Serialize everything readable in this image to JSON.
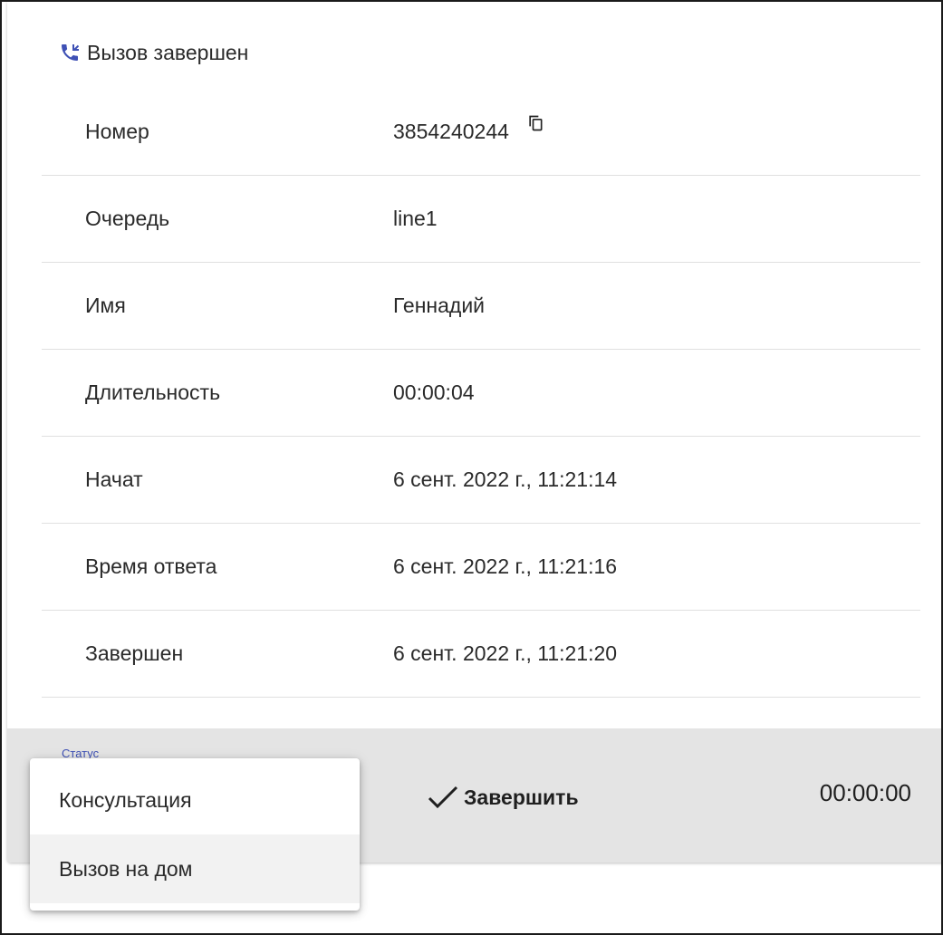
{
  "header": {
    "title": "Вызов завершен",
    "icon": "phone-callback-icon",
    "icon_color": "#3f51b5"
  },
  "details": [
    {
      "label": "Номер",
      "value": "3854240244"
    },
    {
      "label": "Очередь",
      "value": "line1"
    },
    {
      "label": "Имя",
      "value": "Геннадий"
    },
    {
      "label": "Длительность",
      "value": "00:00:04"
    },
    {
      "label": "Начат",
      "value": "6 сент. 2022 г., 11:21:14"
    },
    {
      "label": "Время ответа",
      "value": "6 сент. 2022 г., 11:21:16"
    },
    {
      "label": "Завершен",
      "value": "6 сент. 2022 г., 11:21:20"
    }
  ],
  "footer": {
    "status_label": "Статус",
    "finish_label": "Завершить",
    "timer": "00:00:00",
    "background": "#e4e4e4"
  },
  "status_menu": {
    "options": [
      {
        "label": "Консультация",
        "highlighted": false
      },
      {
        "label": "Вызов на дом",
        "highlighted": true
      }
    ]
  }
}
